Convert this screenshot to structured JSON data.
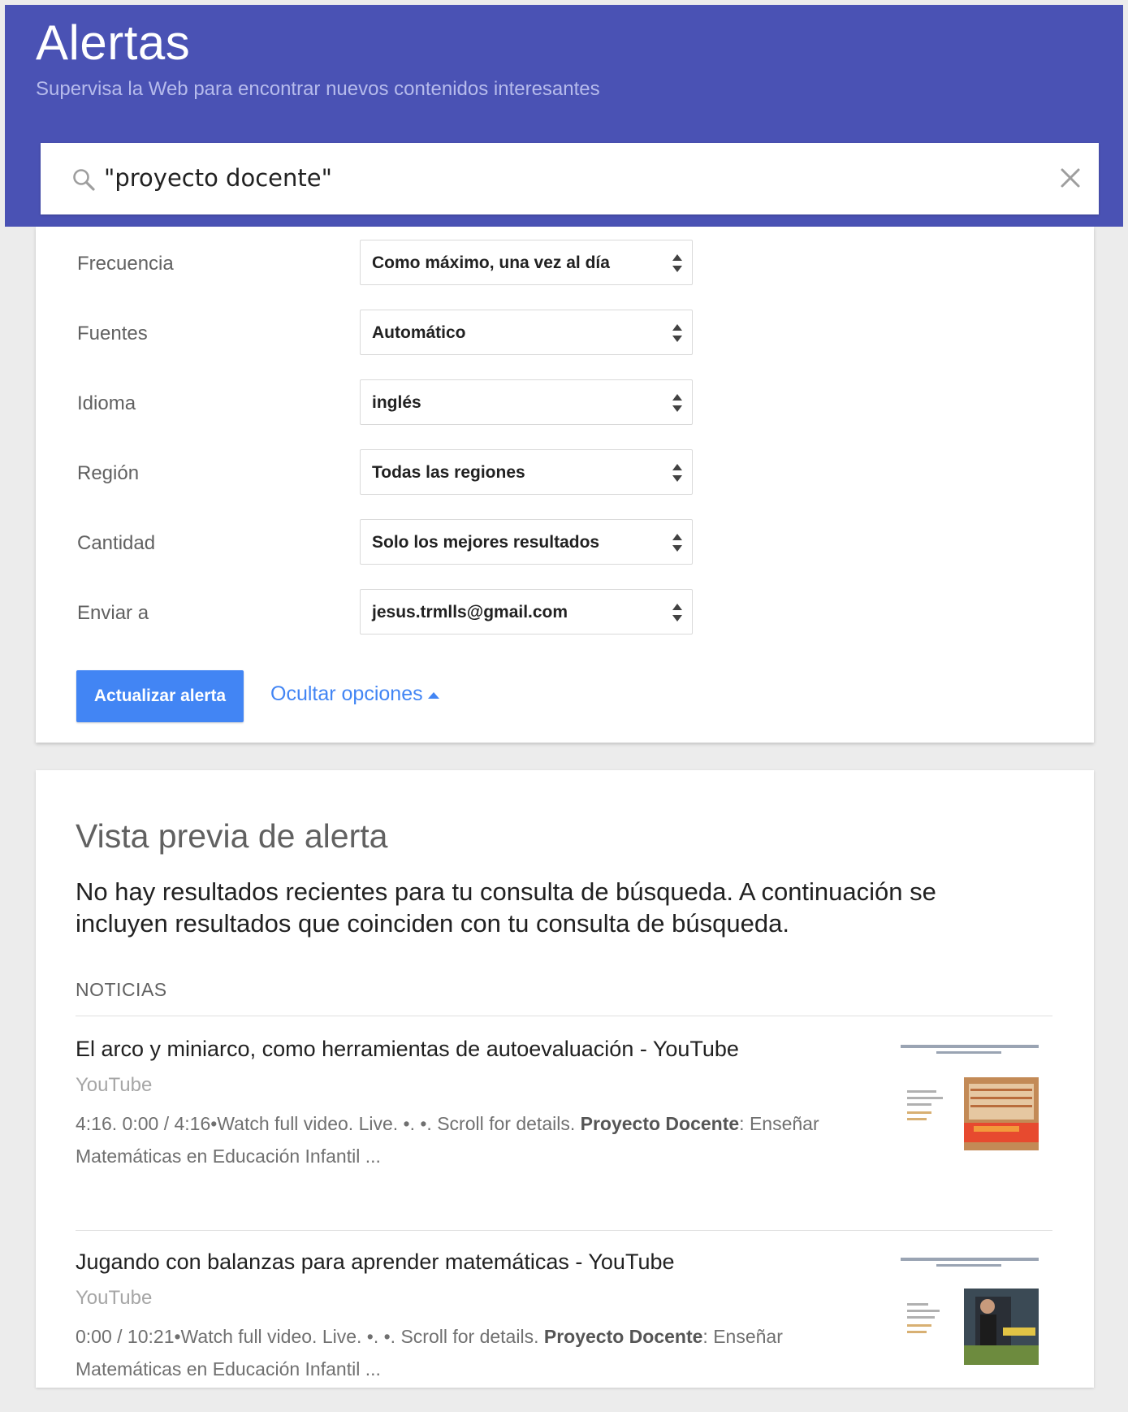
{
  "header": {
    "title": "Alertas",
    "subtitle": "Supervisa la Web para encontrar nuevos contenidos interesantes"
  },
  "search": {
    "value": "\"proyecto docente\""
  },
  "options": [
    {
      "label": "Frecuencia",
      "value": "Como máximo, una vez al día"
    },
    {
      "label": "Fuentes",
      "value": "Automático"
    },
    {
      "label": "Idioma",
      "value": "inglés"
    },
    {
      "label": "Región",
      "value": "Todas las regiones"
    },
    {
      "label": "Cantidad",
      "value": "Solo los mejores resultados"
    },
    {
      "label": "Enviar a",
      "value": "jesus.trmlls@gmail.com"
    }
  ],
  "actions": {
    "update_label": "Actualizar alerta",
    "hide_options_label": "Ocultar opciones"
  },
  "preview": {
    "title": "Vista previa de alerta",
    "no_results_message": "No hay resultados recientes para tu consulta de búsqueda. A continuación se incluyen resultados que coinciden con tu consulta de búsqueda.",
    "section_label": "NOTICIAS",
    "results": [
      {
        "title": "El arco y miniarco, como herramientas de autoevaluación - YouTube",
        "source": "YouTube",
        "snippet_pre": "4:16. 0:00 / 4:16•Watch full video. Live. •. •. Scroll for details. ",
        "snippet_bold": "Proyecto Docente",
        "snippet_post": ": Enseñar Matemáticas en Educación Infantil ..."
      },
      {
        "title": "Jugando con balanzas para aprender matemáticas - YouTube",
        "source": "YouTube",
        "snippet_pre": "0:00 / 10:21•Watch full video. Live. •. •. Scroll for details. ",
        "snippet_bold": "Proyecto Docente",
        "snippet_post": ": Enseñar Matemáticas en Educación Infantil ..."
      }
    ]
  },
  "colors": {
    "header_bg": "#4a52b4",
    "accent_blue": "#4285f4",
    "page_bg": "#ececec"
  },
  "icons": {
    "search": "search-icon",
    "clear": "close-icon",
    "select": "sort-icon",
    "collapse": "caret-up-icon"
  }
}
